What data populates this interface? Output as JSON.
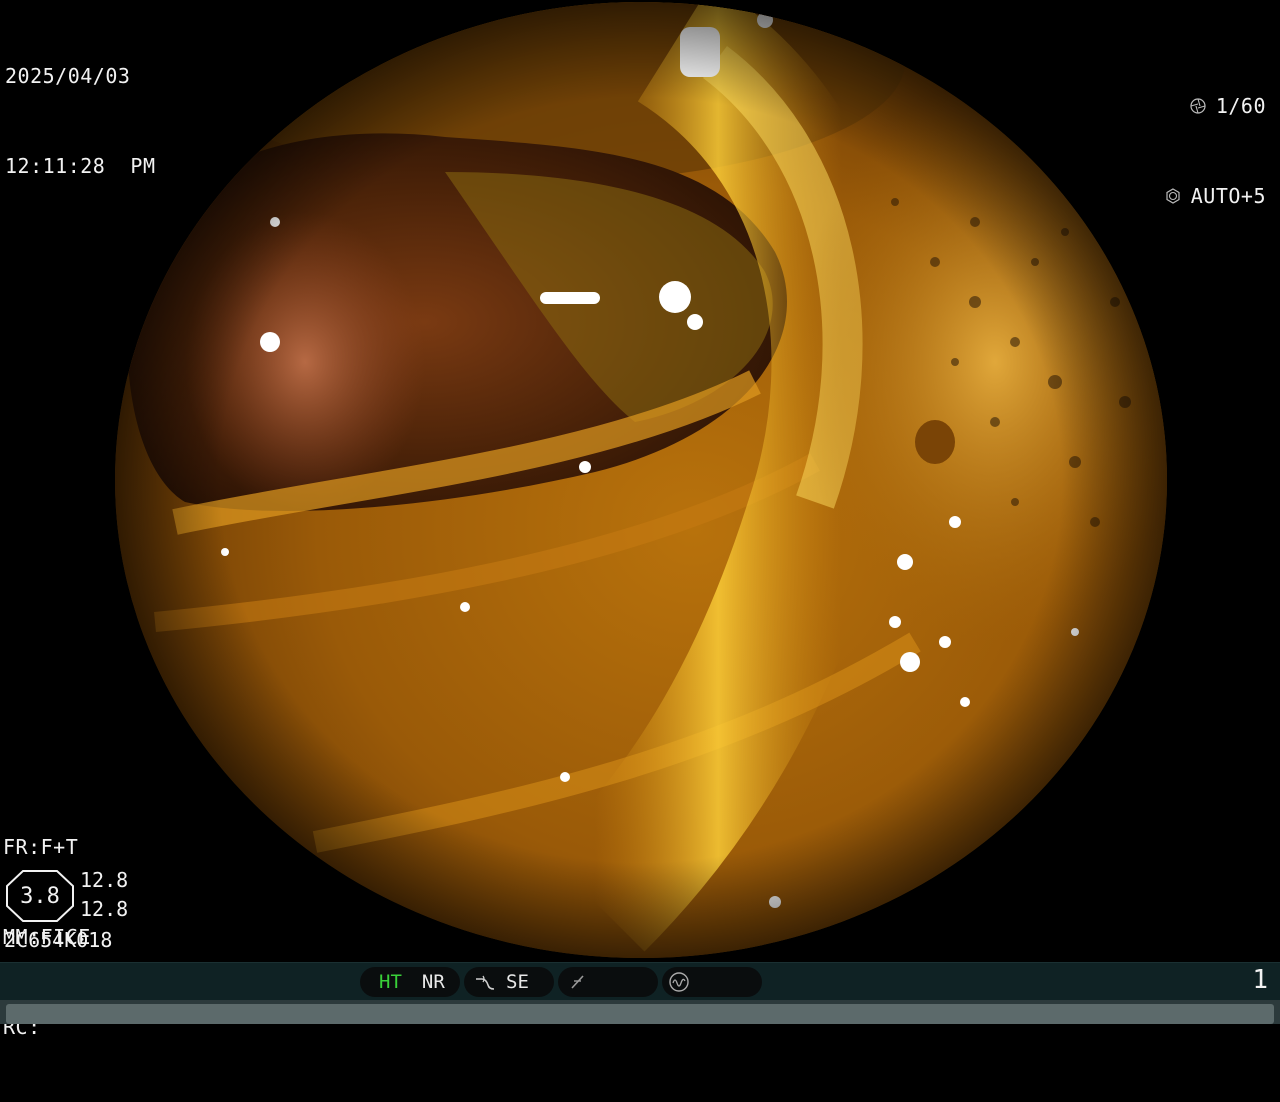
{
  "datetime": {
    "date": "2025/04/03",
    "time": "12:11:28  PM"
  },
  "camera": {
    "shutter_icon": "shutter-icon",
    "shutter": "1/60",
    "iris_icon": "iris-icon",
    "iris": "AUTO+5"
  },
  "settings": {
    "fr": "FR:F+T",
    "mm": "MM:FICE",
    "rc": "RC:"
  },
  "ratio": {
    "center": "3.8",
    "top": "12.8",
    "bottom": "12.8"
  },
  "serial": "2C654K018",
  "statusbar": {
    "ht": "HT",
    "nr": "NR",
    "se_icon": "se-curve-icon",
    "se": "SE",
    "slash_icon": "slash-icon",
    "wave_icon": "wave-circle-icon",
    "page": "1"
  },
  "colors": {
    "ht_active": "#39d039",
    "bar_bg": "#0f2224"
  }
}
